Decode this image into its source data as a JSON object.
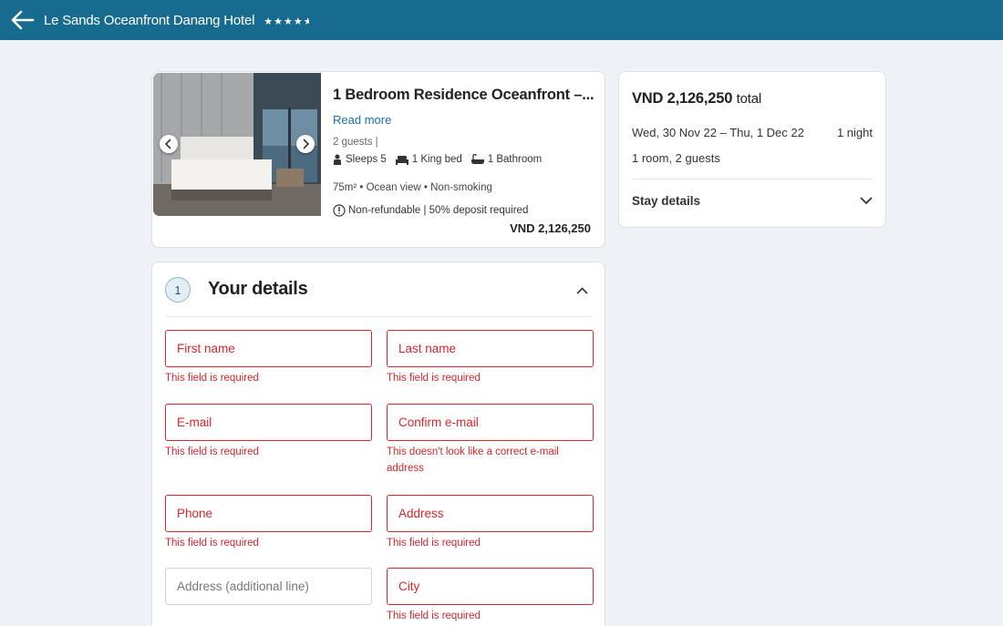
{
  "header": {
    "hotel_name": "Le Sands Oceanfront Danang Hotel",
    "stars": "★★★★",
    "half_star": "★"
  },
  "room": {
    "name": "1 Bedroom Residence Oceanfront –...",
    "read_more": "Read more",
    "guests": "2 guests |",
    "sleeps": "Sleeps 5",
    "bed": "1 King bed",
    "bathroom": "1 Bathroom",
    "features": "75m² • Ocean view • Non-smoking",
    "policy": "Non-refundable | 50% deposit required",
    "price": "VND 2,126,250"
  },
  "summary": {
    "total_amount": "VND 2,126,250",
    "total_suffix": "total",
    "dates": "Wed, 30 Nov 22 – Thu, 1 Dec 22",
    "nights": "1 night",
    "rooms_guests": "1 room, 2 guests",
    "stay_details": "Stay details"
  },
  "details": {
    "step": "1",
    "title": "Your details",
    "fields": {
      "first_name": {
        "placeholder": "First name",
        "error": "This field is required"
      },
      "last_name": {
        "placeholder": "Last name",
        "error": "This field is required"
      },
      "email": {
        "placeholder": "E-mail",
        "error": "This field is required"
      },
      "confirm_email": {
        "placeholder": "Confirm e-mail",
        "error": "This doesn't look like a correct e-mail address"
      },
      "phone": {
        "placeholder": "Phone",
        "error": "This field is required"
      },
      "address": {
        "placeholder": "Address",
        "error": "This field is required"
      },
      "address2": {
        "placeholder": "Address (additional line)"
      },
      "city": {
        "placeholder": "City",
        "error": "This field is required"
      }
    }
  },
  "colors": {
    "header_bg": "#176b8e",
    "error": "#d9262c",
    "link": "#1a6fae",
    "page_bg": "#eef2f7"
  },
  "icons": {
    "back": "arrow-left-icon",
    "prev": "chevron-left-icon",
    "next": "chevron-right-icon",
    "sleeps": "person-icon",
    "bed": "bed-icon",
    "bath": "bathtub-icon",
    "info": "info-circle-icon",
    "stay": "chevron-down-icon",
    "collapse": "chevron-up-icon"
  }
}
